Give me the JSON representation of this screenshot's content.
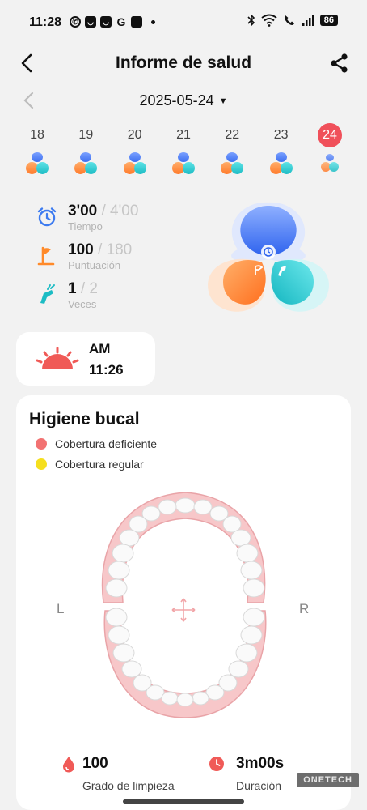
{
  "status_bar": {
    "time": "11:28",
    "battery": "86",
    "left_icons": [
      "whatsapp-icon",
      "app-icon",
      "app-icon",
      "g-icon",
      "app-icon"
    ],
    "right_icons": [
      "bluetooth-icon",
      "wifi-icon",
      "wifi-call-icon",
      "signal-icon",
      "battery-icon"
    ]
  },
  "header": {
    "title": "Informe de salud"
  },
  "date_selector": {
    "date": "2025-05-24",
    "caret": "▼"
  },
  "week": {
    "days": [
      "18",
      "19",
      "20",
      "21",
      "22",
      "23",
      "24"
    ],
    "selected": "24"
  },
  "stats": {
    "time": {
      "value": "3'00",
      "total": "/ 4'00",
      "label": "Tiempo",
      "icon": "alarm-clock-icon",
      "color": "#3d7bf0"
    },
    "score": {
      "value": "100",
      "total": "/ 180",
      "label": "Puntuación",
      "icon": "flag-icon",
      "color": "#ff8a2a"
    },
    "count": {
      "value": "1",
      "total": "/ 2",
      "label": "Veces",
      "icon": "tooth-brush-icon",
      "color": "#1cbcc4"
    }
  },
  "session": {
    "period": "AM",
    "time": "11:26",
    "icon": "sunrise-icon"
  },
  "hygiene": {
    "title": "Higiene bucal",
    "legend": [
      {
        "label": "Cobertura deficiente",
        "color": "#f27272"
      },
      {
        "label": "Cobertura regular",
        "color": "#f5df1e"
      }
    ],
    "left_label": "L",
    "right_label": "R",
    "cleanliness": {
      "value": "100",
      "label": "Grado de limpieza",
      "icon": "drop-icon"
    },
    "duration": {
      "value": "3m00s",
      "label": "Duración",
      "icon": "clock-icon"
    }
  },
  "watermark": "ONETECH",
  "colors": {
    "accent_red": "#f0505a",
    "blue": "#3d6ff0",
    "orange": "#ff7a2a",
    "teal": "#1cbcc4"
  }
}
